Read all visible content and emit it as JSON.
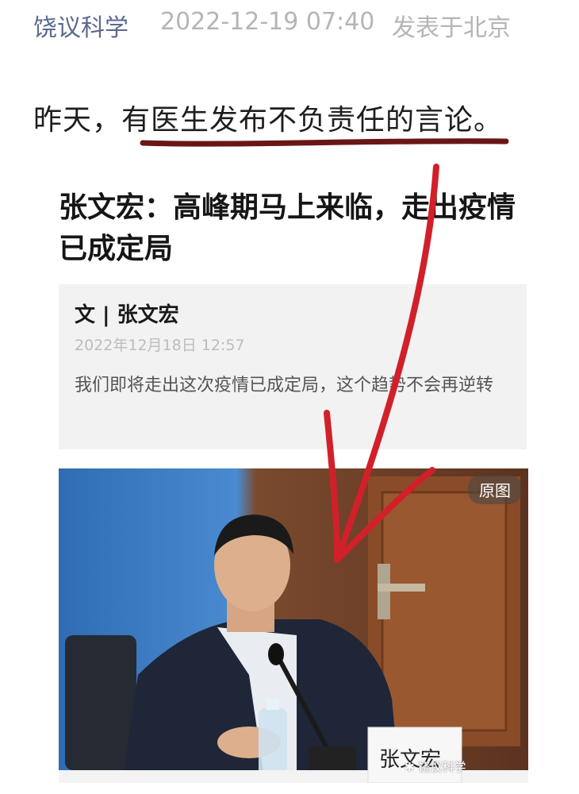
{
  "header": {
    "author": "饶议科学",
    "datetime": "2022-12-19 07:40",
    "location": "发表于北京"
  },
  "post": {
    "text": "昨天，有医生发布不负责任的言论。"
  },
  "embedded": {
    "title": "张文宏：高峰期马上来临，走出疫情已成定局",
    "author_line": "文 | 张文宏",
    "date": "2022年12月18日 12:57",
    "summary": "我们即将走出这次疫情已成定局，这个趋势不会再逆转"
  },
  "photo": {
    "original_button": "原图",
    "nameplate": "张文宏",
    "watermark": "饶议科学"
  },
  "colors": {
    "annotation_red": "#d1202a",
    "underline": "#6a1616"
  }
}
